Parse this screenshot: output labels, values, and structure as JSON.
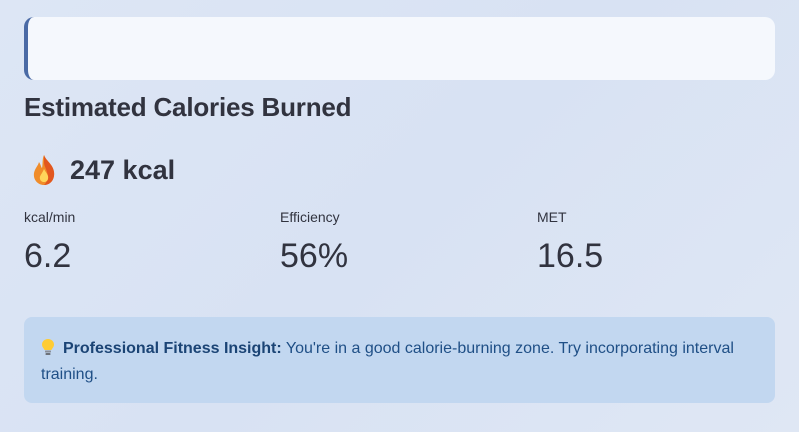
{
  "title": "Estimated Calories Burned",
  "total": {
    "icon": "flame-icon",
    "value": "247 kcal"
  },
  "metrics": [
    {
      "label": "kcal/min",
      "value": "6.2"
    },
    {
      "label": "Efficiency",
      "value": "56%"
    },
    {
      "label": "MET",
      "value": "16.5"
    }
  ],
  "insight": {
    "icon": "lightbulb-icon",
    "heading": "Professional Fitness Insight:",
    "text": "You're in a good calorie-burning zone. Try incorporating interval training."
  },
  "colors": {
    "accent": "#4a6aa5",
    "info_bg": "#c2d7f0",
    "info_text": "#1f4f86"
  }
}
